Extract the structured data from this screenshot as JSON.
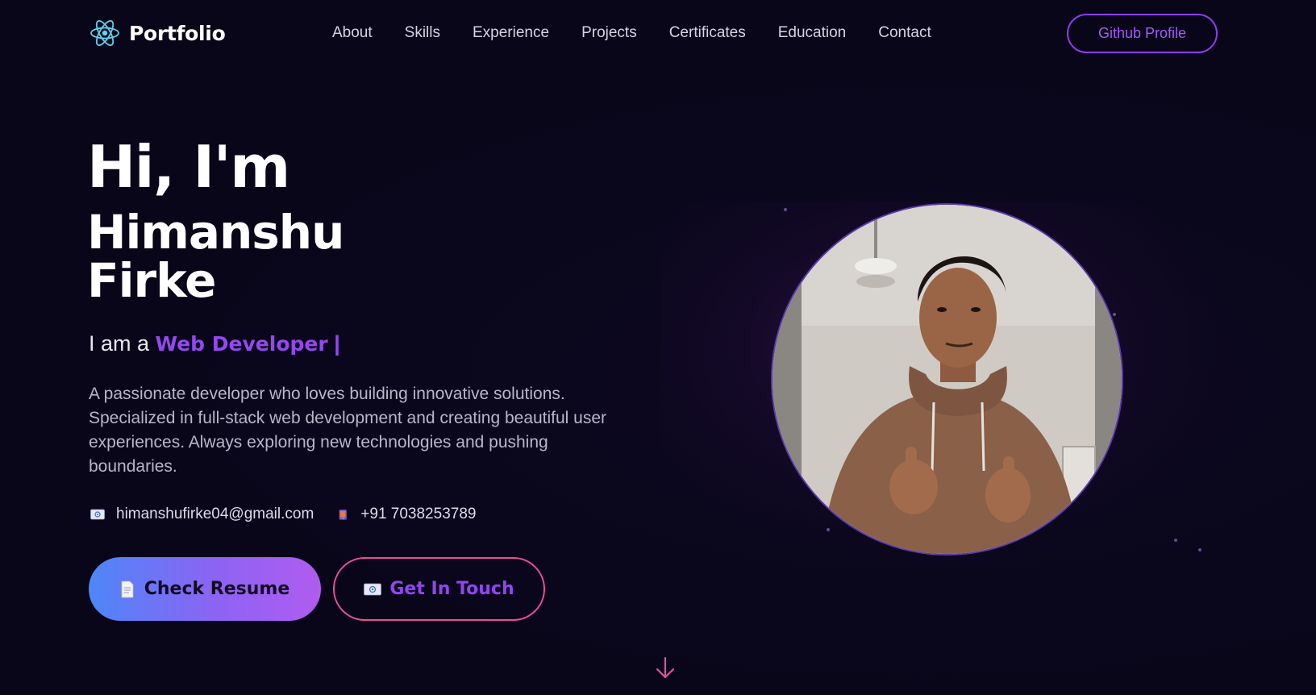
{
  "nav": {
    "brand": "Portfolio",
    "links": [
      "About",
      "Skills",
      "Experience",
      "Projects",
      "Certificates",
      "Education",
      "Contact"
    ],
    "github_button": "Github Profile"
  },
  "hero": {
    "greeting": "Hi, I'm",
    "name": "Himanshu Firke",
    "role_prefix": "I am a",
    "role": "Web Developer",
    "role_cursor": "|",
    "description": "A passionate developer who loves building innovative solutions. Specialized in full-stack web development and creating beautiful user experiences. Always exploring new technologies and pushing boundaries.",
    "email": "himanshufirke04@gmail.com",
    "phone": "+91 7038253789",
    "resume_button": "Check Resume",
    "contact_button": "Get In Touch"
  },
  "icons": {
    "brand": "atom-icon",
    "email": "envelope-icon",
    "phone": "mobile-phone-icon",
    "resume": "document-icon",
    "touch": "envelope-icon",
    "scroll": "arrow-down-icon"
  },
  "colors": {
    "background": "#09061a",
    "accent_purple": "#9448f0",
    "accent_pink": "#e84f96",
    "gradient_start": "#4d86f7",
    "gradient_end": "#b05cf0",
    "brand_icon": "#5fd3f0"
  }
}
